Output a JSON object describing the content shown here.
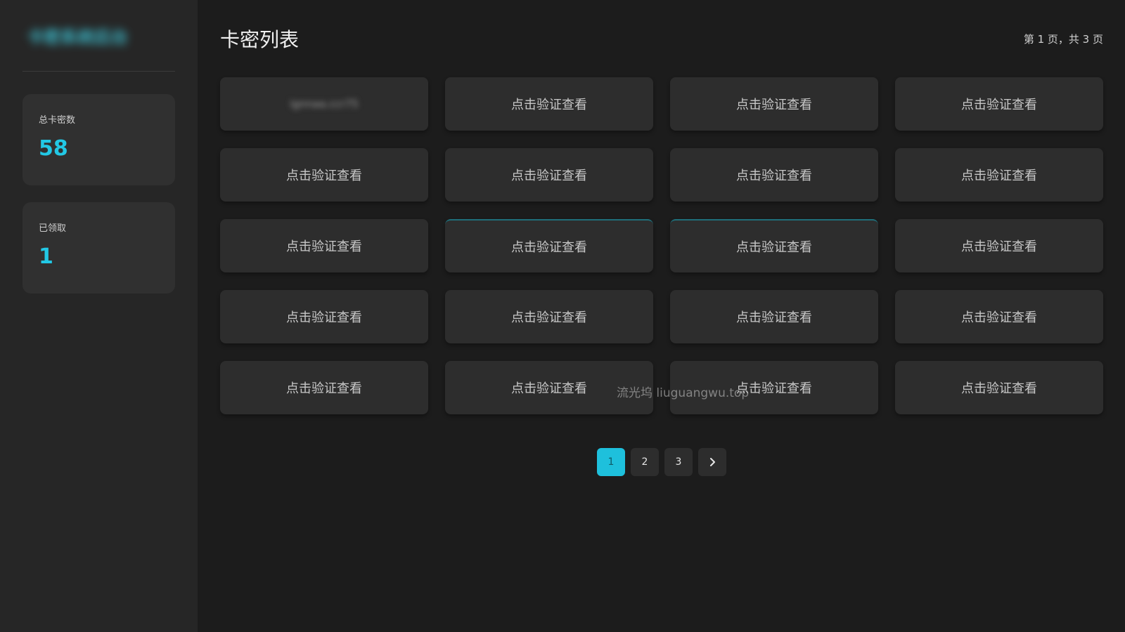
{
  "sidebar": {
    "brand": "卡密系统后台",
    "stats": [
      {
        "label": "总卡密数",
        "value": "58"
      },
      {
        "label": "已领取",
        "value": "1"
      }
    ]
  },
  "header": {
    "title": "卡密列表",
    "page_info": "第 1 页，共 3 页"
  },
  "cards": [
    {
      "label": "ignnaa.ccr75",
      "revealed": true
    },
    {
      "label": "点击验证查看"
    },
    {
      "label": "点击验证查看"
    },
    {
      "label": "点击验证查看"
    },
    {
      "label": "点击验证查看"
    },
    {
      "label": "点击验证查看"
    },
    {
      "label": "点击验证查看"
    },
    {
      "label": "点击验证查看"
    },
    {
      "label": "点击验证查看"
    },
    {
      "label": "点击验证查看"
    },
    {
      "label": "点击验证查看"
    },
    {
      "label": "点击验证查看"
    },
    {
      "label": "点击验证查看"
    },
    {
      "label": "点击验证查看"
    },
    {
      "label": "点击验证查看"
    },
    {
      "label": "点击验证查看"
    },
    {
      "label": "点击验证查看"
    },
    {
      "label": "点击验证查看"
    },
    {
      "label": "点击验证查看"
    },
    {
      "label": "点击验证查看"
    }
  ],
  "watermark": "流光坞 liuguangwu.top",
  "pagination": {
    "pages": [
      "1",
      "2",
      "3"
    ],
    "active": "1",
    "next_icon": "chevron-right-icon"
  },
  "colors": {
    "accent": "#1ec0dc",
    "background": "#1c1c1c",
    "sidebar": "#262626",
    "card": "#2d2d2d"
  }
}
